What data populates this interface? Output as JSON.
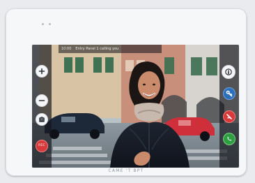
{
  "device": {
    "brand_label": "CAME 'T BPT"
  },
  "screen": {
    "overlay": {
      "time": "10:00",
      "status": "Entry Panel 1 calling you"
    },
    "left_controls": {
      "rec_label": "REC"
    }
  },
  "colors": {
    "accent_red": "#d73a3a",
    "accent_blue": "#2c6fbb",
    "accent_green": "#2f9e42"
  }
}
